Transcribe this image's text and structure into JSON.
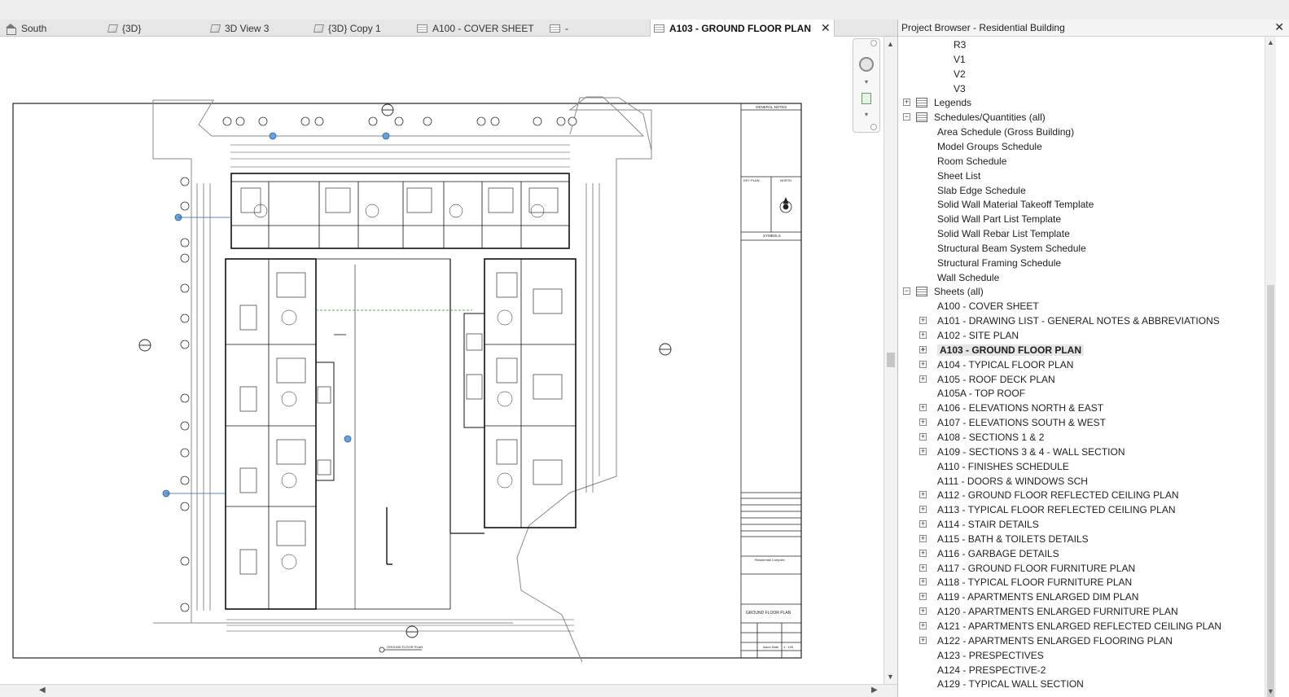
{
  "tabs": [
    {
      "label": "South",
      "icon": "house-icon",
      "active": false
    },
    {
      "label": "{3D}",
      "icon": "cube-3d-icon",
      "active": false
    },
    {
      "label": "3D View 3",
      "icon": "cube-3d-icon",
      "active": false
    },
    {
      "label": "{3D} Copy 1",
      "icon": "cube-3d-icon",
      "active": false
    },
    {
      "label": "A100 - COVER SHEET",
      "icon": "sheet-icon",
      "active": false
    },
    {
      "label": "-",
      "icon": "sheet-icon",
      "active": false
    },
    {
      "label": "A103 - GROUND FLOOR PLAN",
      "icon": "sheet-icon",
      "active": true
    }
  ],
  "close_glyph": "✕",
  "sheet": {
    "title_block": {
      "general_notes": "GENERAL NOTES",
      "key_plan": "KEY PLAN",
      "north": "NORTH",
      "symbols": "SYMBOLS",
      "project_name": "Residential Complex",
      "sheet_name": "GROUND FLOOR PLAN",
      "scale_label": "Issue Date",
      "scale_value": "1 : 100"
    },
    "view_title": "GROUND FLOOR PLAN"
  },
  "project_browser": {
    "title": "Project Browser - Residential Building",
    "close_glyph": "✕",
    "items": [
      {
        "label": "R3",
        "indent": 2,
        "type": "leaf"
      },
      {
        "label": "V1",
        "indent": 2,
        "type": "leaf"
      },
      {
        "label": "V2",
        "indent": 2,
        "type": "leaf"
      },
      {
        "label": "V3",
        "indent": 2,
        "type": "leaf"
      },
      {
        "label": "Legends",
        "indent": 0,
        "type": "group",
        "expander": "+",
        "icon": "legend-icon"
      },
      {
        "label": "Schedules/Quantities (all)",
        "indent": 0,
        "type": "group",
        "expander": "−",
        "icon": "schedule-icon"
      },
      {
        "label": "Area Schedule (Gross Building)",
        "indent": 1,
        "type": "leaf"
      },
      {
        "label": "Model Groups Schedule",
        "indent": 1,
        "type": "leaf"
      },
      {
        "label": "Room Schedule",
        "indent": 1,
        "type": "leaf"
      },
      {
        "label": "Sheet List",
        "indent": 1,
        "type": "leaf"
      },
      {
        "label": "Slab Edge Schedule",
        "indent": 1,
        "type": "leaf"
      },
      {
        "label": "Solid Wall Material Takeoff Template",
        "indent": 1,
        "type": "leaf"
      },
      {
        "label": "Solid Wall Part List Template",
        "indent": 1,
        "type": "leaf"
      },
      {
        "label": "Solid Wall Rebar List Template",
        "indent": 1,
        "type": "leaf"
      },
      {
        "label": "Structural Beam System Schedule",
        "indent": 1,
        "type": "leaf"
      },
      {
        "label": "Structural Framing Schedule",
        "indent": 1,
        "type": "leaf"
      },
      {
        "label": "Wall Schedule",
        "indent": 1,
        "type": "leaf"
      },
      {
        "label": "Sheets (all)",
        "indent": 0,
        "type": "group",
        "expander": "−",
        "icon": "sheets-icon"
      },
      {
        "label": "A100 - COVER SHEET",
        "indent": 1,
        "type": "leaf"
      },
      {
        "label": "A101 - DRAWING LIST - GENERAL NOTES & ABBREVIATIONS",
        "indent": 1,
        "type": "sheet",
        "expander": "+"
      },
      {
        "label": "A102 - SITE PLAN",
        "indent": 1,
        "type": "sheet",
        "expander": "+"
      },
      {
        "label": "A103 - GROUND FLOOR PLAN",
        "indent": 1,
        "type": "sheet",
        "expander": "+",
        "selected": true
      },
      {
        "label": "A104 - TYPICAL FLOOR PLAN",
        "indent": 1,
        "type": "sheet",
        "expander": "+"
      },
      {
        "label": "A105 - ROOF DECK PLAN",
        "indent": 1,
        "type": "sheet",
        "expander": "+"
      },
      {
        "label": "A105A - TOP ROOF",
        "indent": 1,
        "type": "leaf"
      },
      {
        "label": "A106 - ELEVATIONS NORTH & EAST",
        "indent": 1,
        "type": "sheet",
        "expander": "+"
      },
      {
        "label": "A107 - ELEVATIONS SOUTH & WEST",
        "indent": 1,
        "type": "sheet",
        "expander": "+"
      },
      {
        "label": "A108 - SECTIONS 1 & 2",
        "indent": 1,
        "type": "sheet",
        "expander": "+"
      },
      {
        "label": "A109 - SECTIONS 3 & 4 - WALL SECTION",
        "indent": 1,
        "type": "sheet",
        "expander": "+"
      },
      {
        "label": "A110 - FINISHES SCHEDULE",
        "indent": 1,
        "type": "leaf"
      },
      {
        "label": "A111 - DOORS & WINDOWS SCH",
        "indent": 1,
        "type": "leaf"
      },
      {
        "label": "A112 - GROUND FLOOR REFLECTED CEILING PLAN",
        "indent": 1,
        "type": "sheet",
        "expander": "+"
      },
      {
        "label": "A113 - TYPICAL FLOOR REFLECTED CEILING PLAN",
        "indent": 1,
        "type": "sheet",
        "expander": "+"
      },
      {
        "label": "A114 - STAIR DETAILS",
        "indent": 1,
        "type": "sheet",
        "expander": "+"
      },
      {
        "label": "A115 - BATH & TOILETS DETAILS",
        "indent": 1,
        "type": "sheet",
        "expander": "+"
      },
      {
        "label": "A116 - GARBAGE DETAILS",
        "indent": 1,
        "type": "sheet",
        "expander": "+"
      },
      {
        "label": "A117 - GROUND FLOOR FURNITURE PLAN",
        "indent": 1,
        "type": "sheet",
        "expander": "+"
      },
      {
        "label": "A118 - TYPICAL FLOOR FURNITURE PLAN",
        "indent": 1,
        "type": "sheet",
        "expander": "+"
      },
      {
        "label": "A119 - APARTMENTS ENLARGED DIM PLAN",
        "indent": 1,
        "type": "sheet",
        "expander": "+"
      },
      {
        "label": "A120 - APARTMENTS ENLARGED FURNITURE PLAN",
        "indent": 1,
        "type": "sheet",
        "expander": "+"
      },
      {
        "label": "A121 - APARTMENTS ENLARGED REFLECTED CEILING PLAN",
        "indent": 1,
        "type": "sheet",
        "expander": "+"
      },
      {
        "label": "A122 - APARTMENTS ENLARGED FLOORING PLAN",
        "indent": 1,
        "type": "sheet",
        "expander": "+"
      },
      {
        "label": "A123 - PRESPECTIVES",
        "indent": 1,
        "type": "leaf"
      },
      {
        "label": "A124 - PRESPECTIVE-2",
        "indent": 1,
        "type": "leaf"
      },
      {
        "label": "A129 - TYPICAL WALL SECTION",
        "indent": 1,
        "type": "leaf"
      }
    ]
  }
}
